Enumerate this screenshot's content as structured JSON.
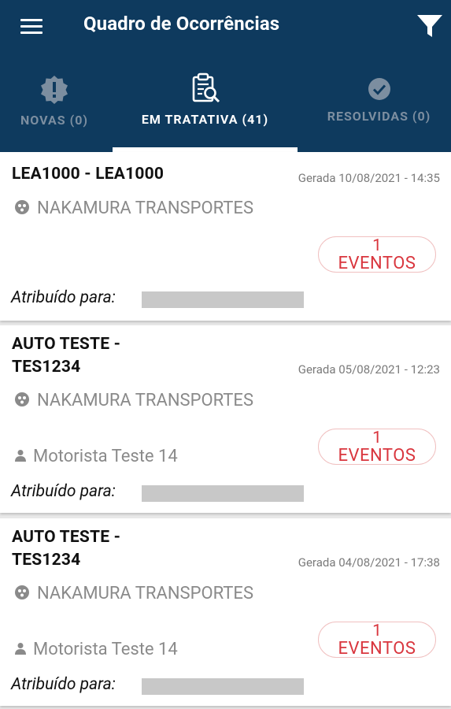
{
  "header": {
    "title": "Quadro de Ocorrências",
    "bg_color": "#0e3a5e"
  },
  "tabs": [
    {
      "label": "NOVAS (0)",
      "icon": "alert-badge-icon",
      "active": false
    },
    {
      "label": "EM TRATATIVA (41)",
      "icon": "clipboard-search-icon",
      "active": true
    },
    {
      "label": "RESOLVIDAS (0)",
      "icon": "check-circle-icon",
      "active": false
    }
  ],
  "cards": [
    {
      "plate": "LEA1000 - LEA1000",
      "generated": "Gerada 10/08/2021 - 14:35",
      "company": "NAKAMURA TRANSPORTES",
      "driver": "",
      "events_count": "1",
      "events_label": "EVENTOS",
      "assigned_label": "Atribuído para:"
    },
    {
      "plate_line1": "AUTO TESTE -",
      "plate_line2": "TES1234",
      "generated": "Gerada 05/08/2021 - 12:23",
      "company": "NAKAMURA TRANSPORTES",
      "driver": "Motorista Teste 14",
      "events_count": "1",
      "events_label": "EVENTOS",
      "assigned_label": "Atribuído para:"
    },
    {
      "plate_line1": "AUTO TESTE -",
      "plate_line2": "TES1234",
      "generated": "Gerada 04/08/2021 - 17:38",
      "company": "NAKAMURA TRANSPORTES",
      "driver": "Motorista Teste 14",
      "events_count": "1",
      "events_label": "EVENTOS",
      "assigned_label": "Atribuído para:"
    }
  ],
  "colors": {
    "accent_red": "#d9363e",
    "inactive_tab": "#7c8ea0"
  }
}
